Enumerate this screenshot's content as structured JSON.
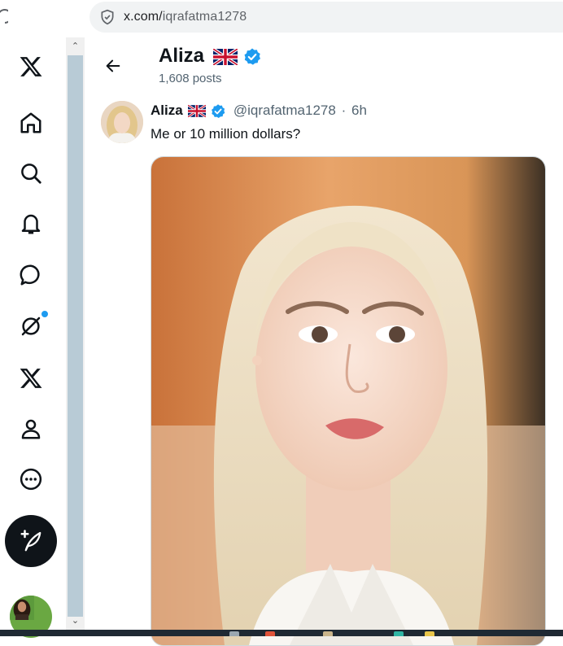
{
  "browser": {
    "url_host": "x.com/",
    "url_path": "iqrafatma1278",
    "shield_icon": "shield-check-icon"
  },
  "nav": {
    "items": [
      {
        "name": "x-logo-icon"
      },
      {
        "name": "home-icon"
      },
      {
        "name": "search-icon"
      },
      {
        "name": "bell-icon"
      },
      {
        "name": "message-icon"
      },
      {
        "name": "grok-icon"
      },
      {
        "name": "premium-x-icon"
      },
      {
        "name": "profile-icon"
      },
      {
        "name": "more-icon"
      }
    ],
    "post_button_icon": "feather-plus-icon"
  },
  "header": {
    "name": "Aliza",
    "flag": "🇬🇧",
    "posts_count": "1,608 posts"
  },
  "tweet": {
    "name": "Aliza",
    "handle": "@iqrafatma1278",
    "separator": "·",
    "time": "6h",
    "text": "Me or 10 million dollars?"
  },
  "colors": {
    "verified_blue": "#1d9bf0",
    "text_primary": "#0f1419",
    "text_secondary": "#536471"
  }
}
